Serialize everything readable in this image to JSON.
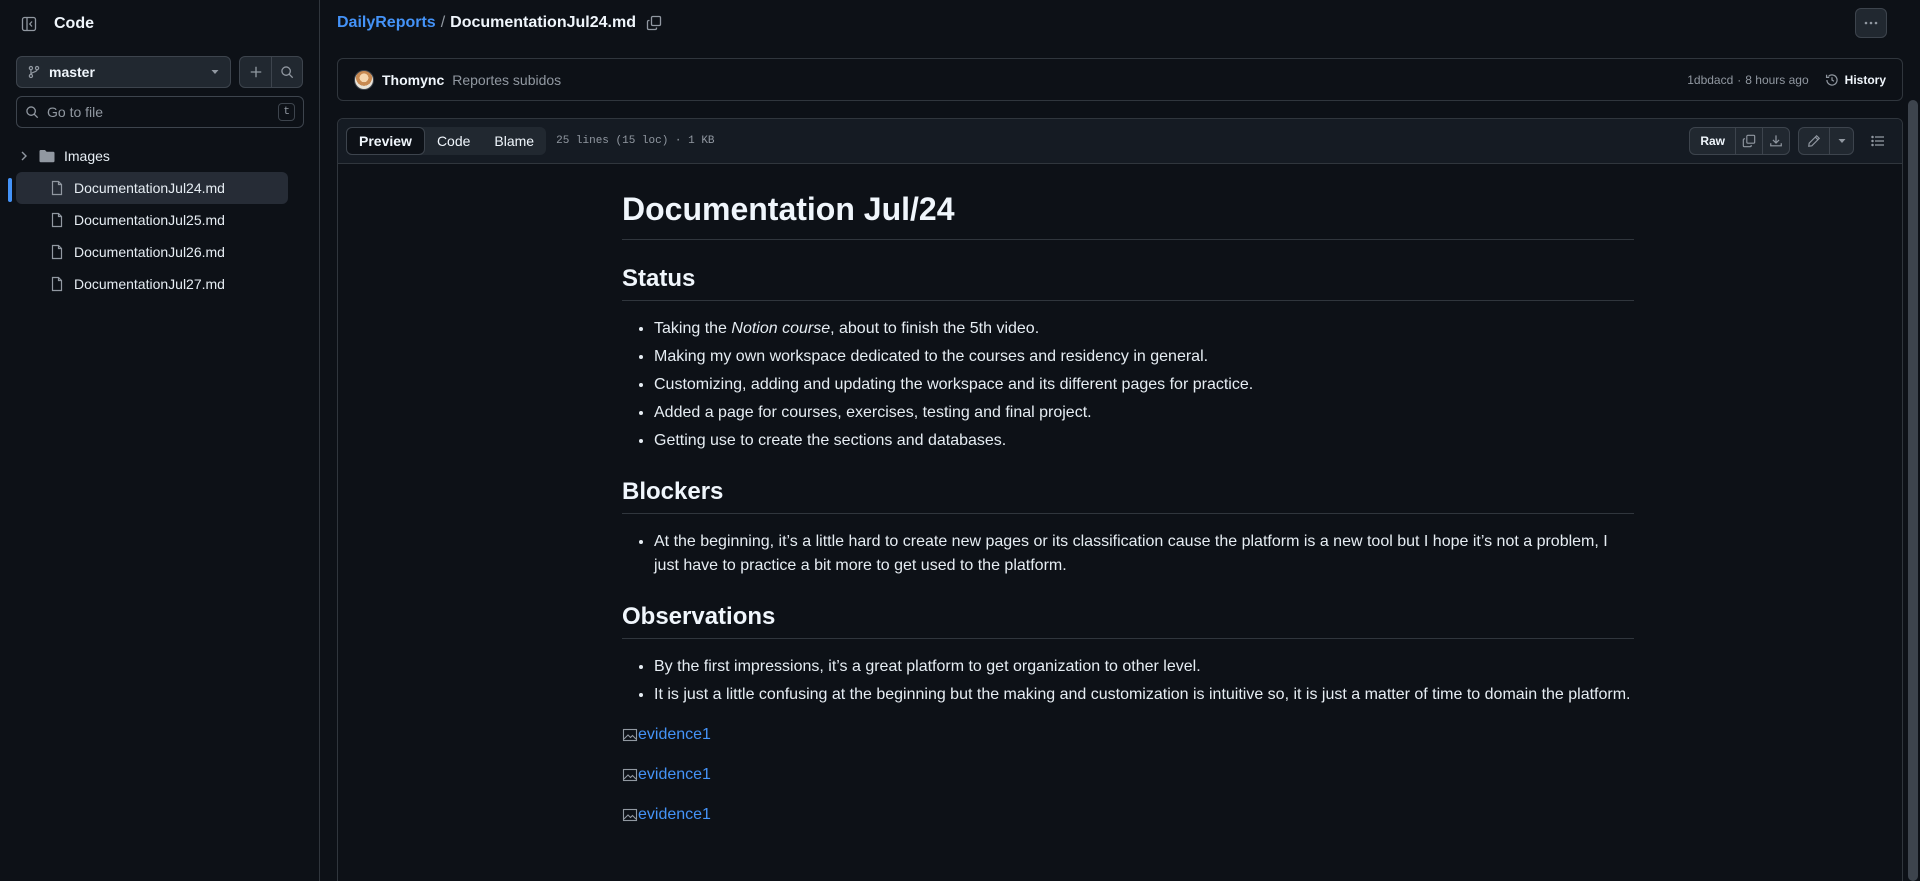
{
  "sidebar": {
    "title": "Code",
    "branch": "master",
    "search_placeholder": "Go to file",
    "search_shortcut": "t",
    "items": [
      {
        "type": "folder",
        "label": "Images"
      },
      {
        "type": "file",
        "label": "DocumentationJul24.md",
        "active": true
      },
      {
        "type": "file",
        "label": "DocumentationJul25.md"
      },
      {
        "type": "file",
        "label": "DocumentationJul26.md"
      },
      {
        "type": "file",
        "label": "DocumentationJul27.md"
      }
    ]
  },
  "breadcrumb": {
    "repo": "DailyReports",
    "separator": "/",
    "file": "DocumentationJul24.md"
  },
  "commit": {
    "author": "Thomync",
    "message": "Reportes subidos",
    "hash": "1dbdacd",
    "meta_sep": "·",
    "time": "8 hours ago",
    "history_label": "History"
  },
  "file_header": {
    "tabs": [
      "Preview",
      "Code",
      "Blame"
    ],
    "stats": "25 lines (15 loc) · 1 KB",
    "raw_label": "Raw"
  },
  "document": {
    "title": "Documentation Jul/24",
    "status_heading": "Status",
    "status_first": {
      "pre": "Taking the ",
      "em": "Notion course",
      "post": ", about to finish the 5th video."
    },
    "status_items": [
      "Making my own workspace dedicated to the courses and residency in general.",
      "Customizing, adding and updating the workspace and its different pages for practice.",
      "Added a page for courses, exercises, testing and final project.",
      "Getting use to create the sections and databases."
    ],
    "blockers_heading": "Blockers",
    "blockers_items": [
      "At the beginning, it’s a little hard to create new pages or its classification cause the platform is a new tool but I hope it’s not a problem, I just have to practice a bit more to get used to the platform."
    ],
    "observations_heading": "Observations",
    "observations_items": [
      "By the first impressions, it’s a great platform to get organization to other level.",
      "It is just a little confusing at the beginning but the making and customization is intuitive so, it is just a matter of time to domain the platform."
    ],
    "evidence": [
      "evidence1",
      "evidence1",
      "evidence1"
    ]
  },
  "colors": {
    "background": "#0d1117",
    "accent": "#4493f8",
    "border": "#30363d",
    "muted": "#9198a1"
  }
}
